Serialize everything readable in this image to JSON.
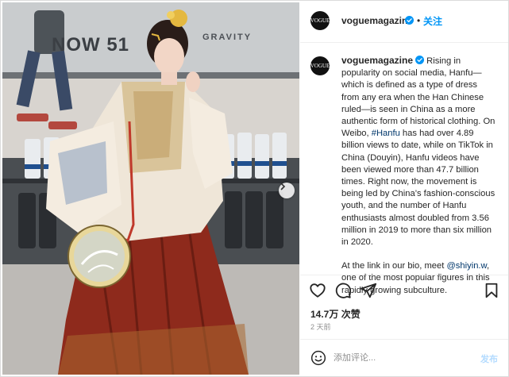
{
  "photo": {
    "sign_text": "NOW 51",
    "sign_logo": "GRAVITY",
    "carousel_next_icon": "chevron-right-icon"
  },
  "header": {
    "avatar_text": "VOGUE",
    "username": "voguemagazine",
    "separator": "•",
    "follow_label": "关注",
    "verified_icon": "verified-badge-icon"
  },
  "caption": {
    "avatar_text": "VOGUE",
    "username": "voguemagazine",
    "text_1": " Rising in popularity on social media, Hanfu—which is defined as a type of dress from any era when the Han Chinese ruled—is seen in China as a more authentic form of historical clothing. On Weibo, ",
    "hashtag": "#Hanfu",
    "text_2": " has had over 4.89 billion views to date, while on TikTok in China (Douyin), Hanfu videos have been viewed more than 47.7 billion times. Right now, the movement is being led by China’s fashion-conscious youth, and the number of Hanfu enthusiasts almost doubled from 3.56 million in 2019 to more than six million in 2020.",
    "text_3": "At the link in our bio, meet ",
    "mention": "@shiyin.w",
    "text_4": ", one of the most popular figures in this rapidly growing subculture."
  },
  "actions": {
    "like_icon": "heart-icon",
    "comment_icon": "comment-icon",
    "share_icon": "paper-plane-icon",
    "save_icon": "bookmark-icon"
  },
  "likes": "14.7万 次赞",
  "time": "2 天前",
  "comment": {
    "emoji_icon": "smiley-icon",
    "placeholder": "添加评论...",
    "post_label": "发布"
  },
  "colors": {
    "link": "#00376b",
    "follow": "#0095f6",
    "post_disabled": "#b3dbff",
    "muted": "#8e8e8e"
  }
}
